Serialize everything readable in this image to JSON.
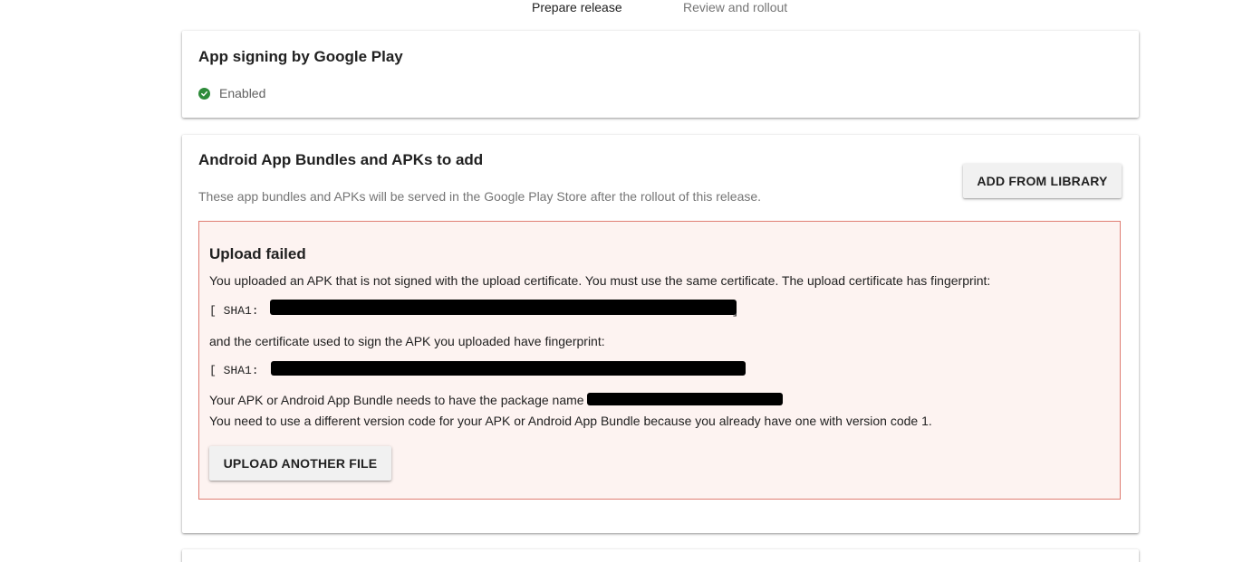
{
  "steps": {
    "active": "Prepare release",
    "inactive": "Review and rollout"
  },
  "signing": {
    "title": "App signing by Google Play",
    "status": "Enabled",
    "status_icon": "check-circle-icon",
    "status_color": "#2e8b3a"
  },
  "bundles": {
    "title": "Android App Bundles and APKs to add",
    "description": "These app bundles and APKs will be served in the Google Play Store after the rollout of this release.",
    "add_button": "ADD FROM LIBRARY",
    "error": {
      "title": "Upload failed",
      "line1": "You uploaded an APK that is not signed with the upload certificate. You must use the same certificate. The upload certificate has fingerprint:",
      "sha1_prefix": "[ SHA1:",
      "sha1_suffix": "]",
      "line2": "and the certificate used to sign the APK you uploaded have fingerprint:",
      "sha2_prefix": "[ SHA1:",
      "line3": "Your APK or Android App Bundle needs to have the package name",
      "line4": "You need to use a different version code for your APK or Android App Bundle because you already have one with version code 1.",
      "upload_button": "UPLOAD ANOTHER FILE",
      "border_color": "#df7d73",
      "background_color": "#fdf3f1"
    }
  }
}
